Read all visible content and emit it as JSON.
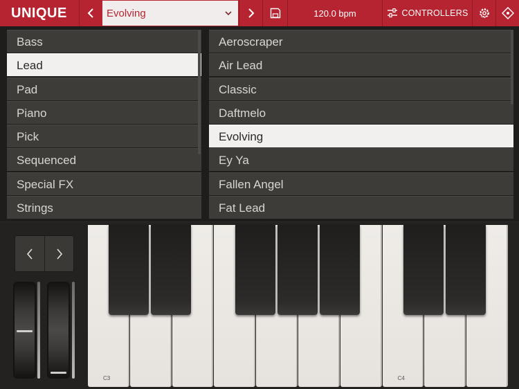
{
  "header": {
    "logo": "UNIQUE",
    "preset_name": "Evolving",
    "tempo": "120.0 bpm",
    "controllers_label": "CONTROLLERS"
  },
  "colors": {
    "accent": "#b52430",
    "selected_row": "#f2f0ee",
    "row": "#3d3c39"
  },
  "categories": [
    {
      "label": "Bass",
      "selected": false
    },
    {
      "label": "Lead",
      "selected": true
    },
    {
      "label": "Pad",
      "selected": false
    },
    {
      "label": "Piano",
      "selected": false
    },
    {
      "label": "Pick",
      "selected": false
    },
    {
      "label": "Sequenced",
      "selected": false
    },
    {
      "label": "Special FX",
      "selected": false
    },
    {
      "label": "Strings",
      "selected": false
    }
  ],
  "presets": [
    {
      "label": "Aeroscraper",
      "selected": false
    },
    {
      "label": "Air Lead",
      "selected": false
    },
    {
      "label": "Classic",
      "selected": false
    },
    {
      "label": "Daftmelo",
      "selected": false
    },
    {
      "label": "Evolving",
      "selected": true
    },
    {
      "label": "Ey Ya",
      "selected": false
    },
    {
      "label": "Fallen Angel",
      "selected": false
    },
    {
      "label": "Fat Lead",
      "selected": false
    }
  ],
  "keyboard": {
    "octave_labels": [
      "C3",
      "C4"
    ]
  },
  "icons": [
    "chevron-left-icon",
    "chevron-right-icon",
    "chevron-down-icon",
    "save-icon",
    "sliders-icon",
    "gear-icon",
    "midi-icon"
  ]
}
